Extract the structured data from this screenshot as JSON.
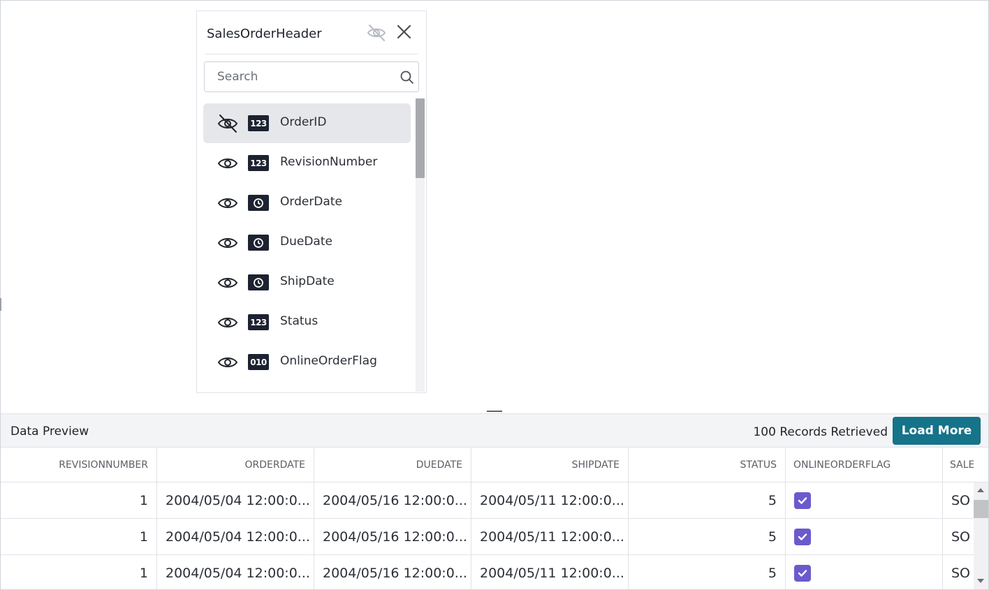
{
  "panel": {
    "title": "SalesOrderHeader",
    "hide_all_icon": "eye-off-icon",
    "close_icon": "close-icon",
    "search": {
      "placeholder": "Search",
      "value": "",
      "icon": "search-icon"
    },
    "columns": [
      {
        "name": "OrderID",
        "type_badge": "123",
        "visibility": "hidden",
        "active": true
      },
      {
        "name": "RevisionNumber",
        "type_badge": "123",
        "visibility": "visible",
        "active": false
      },
      {
        "name": "OrderDate",
        "type_badge": "clock",
        "visibility": "visible",
        "active": false
      },
      {
        "name": "DueDate",
        "type_badge": "clock",
        "visibility": "visible",
        "active": false
      },
      {
        "name": "ShipDate",
        "type_badge": "clock",
        "visibility": "visible",
        "active": false
      },
      {
        "name": "Status",
        "type_badge": "123",
        "visibility": "visible",
        "active": false
      },
      {
        "name": "OnlineOrderFlag",
        "type_badge": "010",
        "visibility": "visible",
        "active": false
      }
    ]
  },
  "preview": {
    "title": "Data Preview",
    "records_label": "100 Records Retrieved",
    "load_more_label": "Load More",
    "accent_color": "#15738a",
    "checkbox_color": "#6a5acd",
    "headers": [
      "REVISIONNUMBER",
      "ORDERDATE",
      "DUEDATE",
      "SHIPDATE",
      "STATUS",
      "ONLINEORDERFLAG",
      "SALE"
    ],
    "rows": [
      {
        "revision": "1",
        "orderdate": "2004/05/04 12:00:0...",
        "duedate": "2004/05/16 12:00:0...",
        "shipdate": "2004/05/11 12:00:0...",
        "status": "5",
        "online": true,
        "sale": "SO"
      },
      {
        "revision": "1",
        "orderdate": "2004/05/04 12:00:0...",
        "duedate": "2004/05/16 12:00:0...",
        "shipdate": "2004/05/11 12:00:0...",
        "status": "5",
        "online": true,
        "sale": "SO"
      },
      {
        "revision": "1",
        "orderdate": "2004/05/04 12:00:0...",
        "duedate": "2004/05/16 12:00:0...",
        "shipdate": "2004/05/11 12:00:0...",
        "status": "5",
        "online": true,
        "sale": "SO"
      }
    ]
  }
}
